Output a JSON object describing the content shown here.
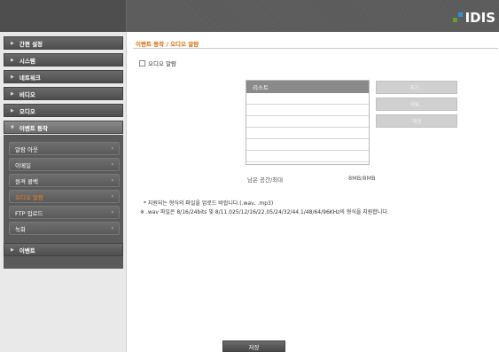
{
  "brand": {
    "logo_text": "IDIS",
    "colors": {
      "green": "#5aa12f",
      "blue": "#2f8fd1"
    }
  },
  "sidebar": {
    "items": [
      {
        "label": "간편 설정",
        "arrow": "▶"
      },
      {
        "label": "시스템",
        "arrow": "▶"
      },
      {
        "label": "네트워크",
        "arrow": "▶"
      },
      {
        "label": "비디오",
        "arrow": "▶"
      },
      {
        "label": "오디오",
        "arrow": "▶"
      },
      {
        "label": "이벤트 동작",
        "arrow": "▼"
      }
    ],
    "submenu": [
      {
        "label": "알람 아웃",
        "chev": "›"
      },
      {
        "label": "이메일",
        "chev": "›"
      },
      {
        "label": "원격 콜백",
        "chev": "›"
      },
      {
        "label": "오디오 알람",
        "chev": "›",
        "active": true
      },
      {
        "label": "FTP 업로드",
        "chev": "›"
      },
      {
        "label": "녹화",
        "chev": "›"
      }
    ],
    "after": {
      "label": "이벤트",
      "arrow": "▶"
    }
  },
  "content": {
    "title": "이벤트 동작 / 오디오 알람",
    "checkbox_label": "오디오 알람",
    "list_header": "리스트",
    "buttons": [
      "추가...",
      "삭제...",
      "재생"
    ],
    "space_label": "남은 공간/최대",
    "space_value": "8MB/8MB",
    "note1": "* 지원되는 형식의 파일을 업로드 바랍니다.(.wav, .mp3)",
    "note2": "※ .wav 파일은 8/16/24bits 및 8/11.025/12/16/22.05/24/32/44.1/48/64/96KHz의 형식을 지원합니다.",
    "save_label": "저장"
  }
}
